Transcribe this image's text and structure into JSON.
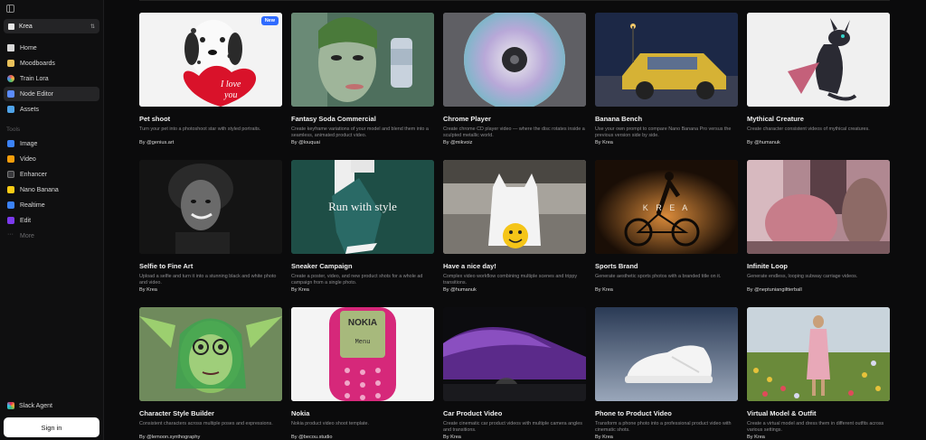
{
  "sidebar": {
    "workspace": "Krea",
    "nav": [
      {
        "label": "Home",
        "icon": "home-icon",
        "color": "#d9d9d9"
      },
      {
        "label": "Moodboards",
        "icon": "moodboard-icon",
        "color": "#e8c05a"
      },
      {
        "label": "Train Lora",
        "icon": "lora-icon",
        "color": "#e45a5a"
      },
      {
        "label": "Node Editor",
        "icon": "node-editor-icon",
        "color": "#5b8cff"
      },
      {
        "label": "Assets",
        "icon": "folder-icon",
        "color": "#4fa3e8"
      }
    ],
    "tools_label": "Tools",
    "tools": [
      {
        "label": "Image",
        "icon": "image-icon",
        "color": "#3b82f6"
      },
      {
        "label": "Video",
        "icon": "video-icon",
        "color": "#f59e0b"
      },
      {
        "label": "Enhancer",
        "icon": "enhancer-icon",
        "color": "#444"
      },
      {
        "label": "Nano Banana",
        "icon": "banana-icon",
        "color": "#facc15"
      },
      {
        "label": "Realtime",
        "icon": "realtime-icon",
        "color": "#3b82f6"
      },
      {
        "label": "Edit",
        "icon": "edit-icon",
        "color": "#7c3aed"
      }
    ],
    "more_label": "More",
    "slack_label": "Slack Agent",
    "signin_label": "Sign in"
  },
  "cards": [
    {
      "title": "Pet shoot",
      "desc": "Turn your pet into a photoshoot star with styled portraits.",
      "author_prefix": "By",
      "author": "@genius.art",
      "badge": "New"
    },
    {
      "title": "Fantasy Soda Commercial",
      "desc": "Create keyframe variations of your model and blend them into a seamless, animated product video.",
      "author_prefix": "By",
      "author": "@louquai"
    },
    {
      "title": "Chrome Player",
      "desc": "Create chrome CD player video — where the disc rotates inside a sculpted metallic world.",
      "author_prefix": "By",
      "author": "@mikvoiz"
    },
    {
      "title": "Banana Bench",
      "desc": "Use your own prompt to compare Nano Banana Pro versus the previous version side by side.",
      "author_prefix": "By",
      "author": "Krea"
    },
    {
      "title": "Mythical Creature",
      "desc": "Create character consistent videos of mythical creatures.",
      "author_prefix": "By",
      "author": "@humanuk"
    },
    {
      "title": "Selfie to Fine Art",
      "desc": "Upload a selfie and turn it into a stunning black and white photo and video.",
      "author_prefix": "By",
      "author": "Krea"
    },
    {
      "title": "Sneaker Campaign",
      "desc": "Create a poster, video, and new product shots for a whole ad campaign from a single photo.",
      "author_prefix": "By",
      "author": "Krea",
      "overlay": "Run with style"
    },
    {
      "title": "Have a nice day!",
      "desc": "Complex video workflow combining multiple scenes and trippy transitions.",
      "author_prefix": "By",
      "author": "@humanuk"
    },
    {
      "title": "Sports Brand",
      "desc": "Generate aesthetic sports photos with a branded title on it.",
      "author_prefix": "By",
      "author": "Krea",
      "overlay": "K R E A"
    },
    {
      "title": "Infinite Loop",
      "desc": "Generate endless, looping subway carriage videos.",
      "author_prefix": "By",
      "author": "@neptuniangiltterball"
    },
    {
      "title": "Character Style Builder",
      "desc": "Consistent characters across multiple poses and expressions.",
      "author_prefix": "By",
      "author": "@lemoon.synthography"
    },
    {
      "title": "Nokia",
      "desc": "Nokia product video shoot template.",
      "author_prefix": "By",
      "author": "@becou.studio",
      "overlay": "NOKIA",
      "overlay2": "Menu"
    },
    {
      "title": "Car Product Video",
      "desc": "Create cinematic car product videos with multiple camera angles and transitions.",
      "author_prefix": "By",
      "author": "Krea"
    },
    {
      "title": "Phone to Product Video",
      "desc": "Transform a phone photo into a professional product video with cinematic shots.",
      "author_prefix": "By",
      "author": "Krea"
    },
    {
      "title": "Virtual Model & Outfit",
      "desc": "Create a virtual model and dress them in different outfits across various settings.",
      "author_prefix": "By",
      "author": "Krea"
    }
  ],
  "thumb_colors": [
    "#f2f2f2",
    "#3c5a4c",
    "#6b6b70",
    "#1e2a45",
    "#efefef",
    "#1a1a1a",
    "#1d4a42",
    "#8c8a86",
    "#2a1a0f",
    "#c9a0a5",
    "#6f8a5c",
    "#f4f4f4",
    "#0d0d10",
    "#7a8aa3",
    "#c7b3a0"
  ]
}
